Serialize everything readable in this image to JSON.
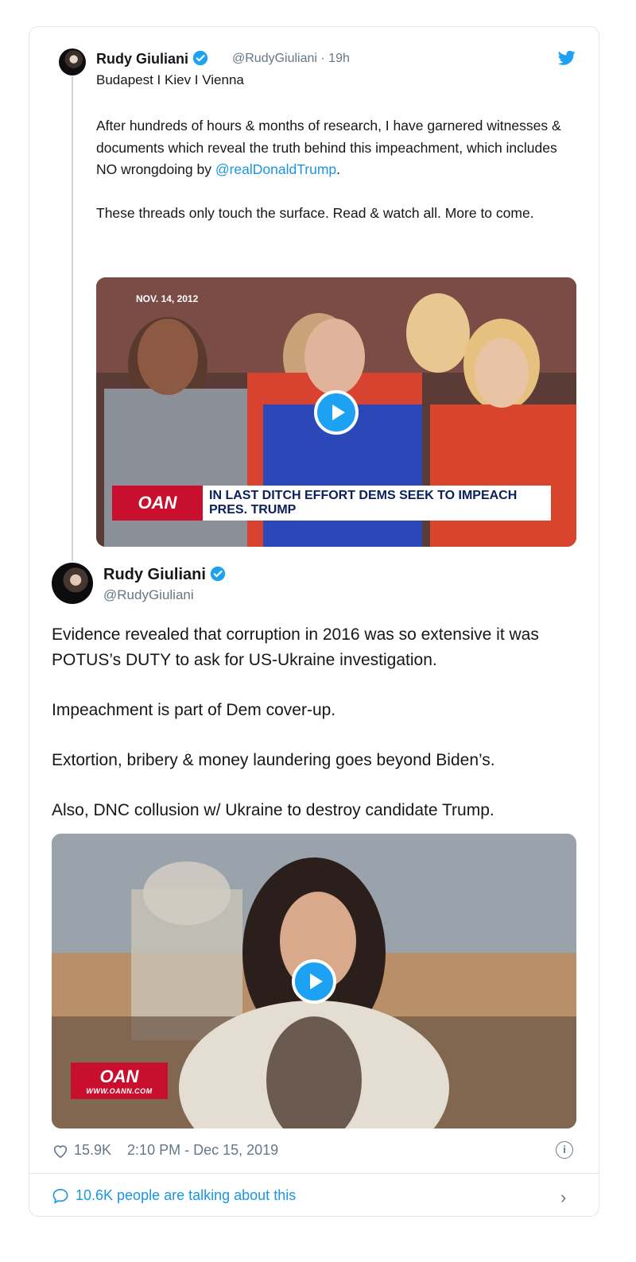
{
  "tweet1": {
    "name": "Rudy Giuliani",
    "handle": "@RudyGiuliani · 19h",
    "location": "Budapest I Kiev I Vienna",
    "text_part1": "After hundreds of hours & months of research, I have garnered witnesses & documents which reveal the truth behind this impeachment, which includes NO wrongdoing by ",
    "mention": "@realDonaldTrump",
    "text_part1_end": ".",
    "text_part2": "These threads only touch the surface. Read & watch all. More to come.",
    "video": {
      "date_stamp": "NOV. 14, 2012",
      "logo": "OAN",
      "headline": "IN LAST DITCH EFFORT DEMS SEEK TO IMPEACH PRES. TRUMP"
    }
  },
  "tweet2": {
    "name": "Rudy Giuliani",
    "handle": "@RudyGiuliani",
    "paragraphs": [
      "Evidence revealed that corruption in 2016 was so extensive it was POTUS’s DUTY to ask for US-Ukraine investigation.",
      "Impeachment is part of Dem cover-up.",
      "Extortion, bribery & money laundering goes beyond Biden’s.",
      "Also, DNC collusion w/ Ukraine to destroy candidate Trump."
    ],
    "video": {
      "logo": "OAN",
      "logo_url": "WWW.OANN.COM"
    },
    "likes": "15.9K",
    "timestamp": "2:10 PM - Dec 15, 2019",
    "talking": "10.6K people are talking about this"
  },
  "colors": {
    "accent": "#1da1f2",
    "link": "#1b95e0",
    "muted": "#657786",
    "border": "#e1e8ed"
  },
  "icons": {
    "verified": "verified-badge-icon",
    "twitter": "twitter-bird-icon",
    "play": "play-icon",
    "like": "heart-icon",
    "info": "info-icon",
    "reply": "speech-bubble-icon",
    "chevron": "chevron-right-icon"
  }
}
